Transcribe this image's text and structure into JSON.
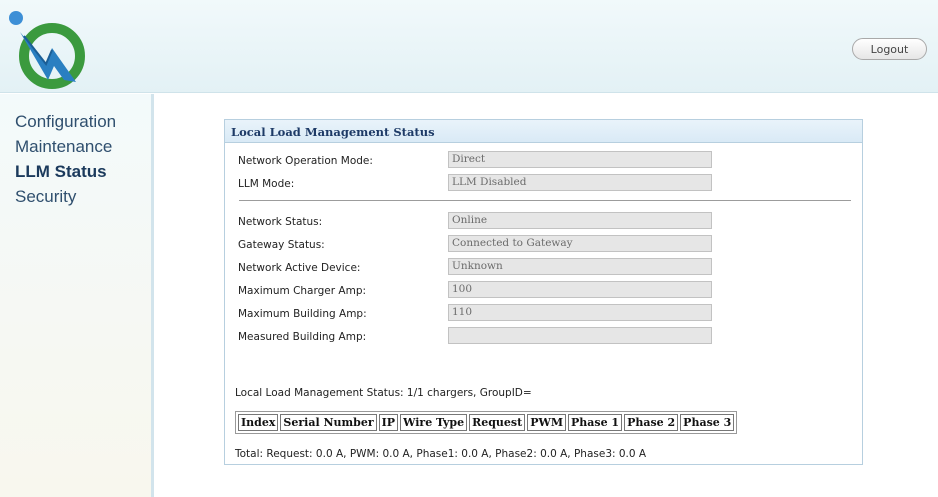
{
  "header": {
    "logout_label": "Logout"
  },
  "sidebar": {
    "items": [
      {
        "label": "Configuration"
      },
      {
        "label": "Maintenance"
      },
      {
        "label": "LLM Status"
      },
      {
        "label": "Security"
      }
    ],
    "active": "LLM Status"
  },
  "panel": {
    "title": "Local Load Management Status",
    "fields": [
      {
        "label": "Network Operation Mode:",
        "value": "Direct"
      },
      {
        "label": "LLM Mode:",
        "value": "LLM Disabled"
      },
      {
        "label": "Network Status:",
        "value": "Online"
      },
      {
        "label": "Gateway Status:",
        "value": "Connected to Gateway"
      },
      {
        "label": "Network Active Device:",
        "value": "Unknown"
      },
      {
        "label": "Maximum Charger Amp:",
        "value": "100"
      },
      {
        "label": "Maximum Building Amp:",
        "value": "110"
      },
      {
        "label": "Measured Building Amp:",
        "value": ""
      }
    ],
    "status_line": "Local Load Management Status: 1/1 chargers, GroupID=",
    "table_headers": [
      "Index",
      "Serial Number",
      "IP",
      "Wire Type",
      "Request",
      "PWM",
      "Phase 1",
      "Phase 2",
      "Phase 3"
    ],
    "total_line": "Total: Request: 0.0 A, PWM: 0.0 A, Phase1: 0.0 A, Phase2: 0.0 A, Phase3: 0.0 A"
  },
  "colors": {
    "logo_green": "#3b9a3e",
    "logo_blue": "#2a7fc1",
    "panel_title": "#1d3a66",
    "nav_text": "#2f4f6e"
  }
}
